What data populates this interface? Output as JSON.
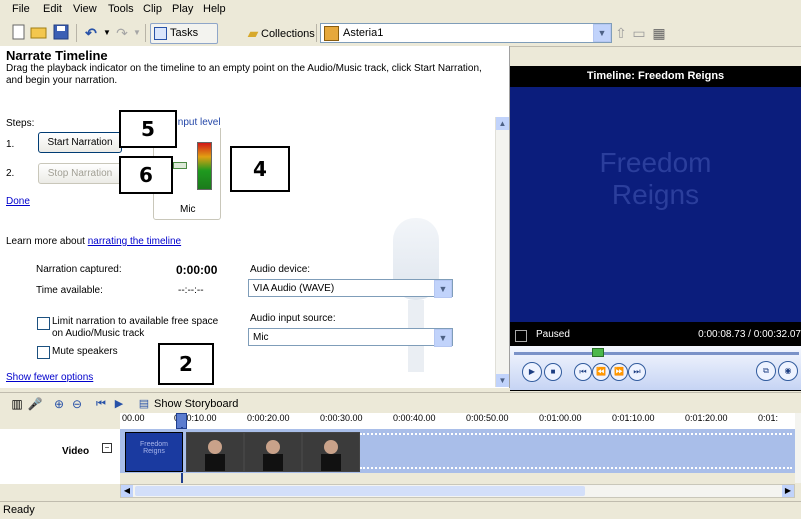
{
  "menu": [
    "File",
    "Edit",
    "View",
    "Tools",
    "Clip",
    "Play",
    "Help"
  ],
  "toolbar": {
    "tasks_label": "Tasks",
    "collections_label": "Collections",
    "project_value": "Asteria1"
  },
  "narrate": {
    "title": "Narrate Timeline",
    "description": "Drag the playback indicator on the timeline to an empty point on the Audio/Music track, click Start Narration, and begin your narration.",
    "steps_label": "Steps:",
    "step1_num": "1.",
    "step2_num": "2.",
    "start_button": "Start Narration",
    "stop_button": "Stop Narration",
    "input_level_label": "Input level",
    "mic_label": "Mic",
    "done_link": "Done",
    "learn_more_prefix": "Learn more about ",
    "learn_more_link": "narrating the timeline",
    "captured_label": "Narration captured:",
    "captured_value": "0:00:00",
    "available_label": "Time available:",
    "available_value": "--:--:--",
    "audio_device_label": "Audio device:",
    "audio_device_value": "VIA Audio (WAVE)",
    "input_source_label": "Audio input source:",
    "input_source_value": "Mic",
    "limit_label_line1": "Limit narration to available free space",
    "limit_label_line2": "on Audio/Music track",
    "mute_label": "Mute speakers",
    "fewer_options_link": "Show fewer options"
  },
  "callouts": {
    "c2": "2",
    "c4": "4",
    "c5": "5",
    "c6": "6"
  },
  "preview": {
    "title": "Timeline: Freedom Reigns",
    "screen_text_1": "Freedom",
    "screen_text_2": "Reigns",
    "status": "Paused",
    "time": "0:00:08.73 / 0:00:32.07"
  },
  "timeline": {
    "show_storyboard": "Show Storyboard",
    "ticks": [
      "00.00",
      "0:00:10.00",
      "0:00:20.00",
      "0:00:30.00",
      "0:00:40.00",
      "0:00:50.00",
      "0:01:00.00",
      "0:01:10.00",
      "0:01:20.00",
      "0:01:"
    ],
    "video_label": "Video",
    "title_clip_line1": "Freedom",
    "title_clip_line2": "Reigns"
  },
  "status": "Ready"
}
